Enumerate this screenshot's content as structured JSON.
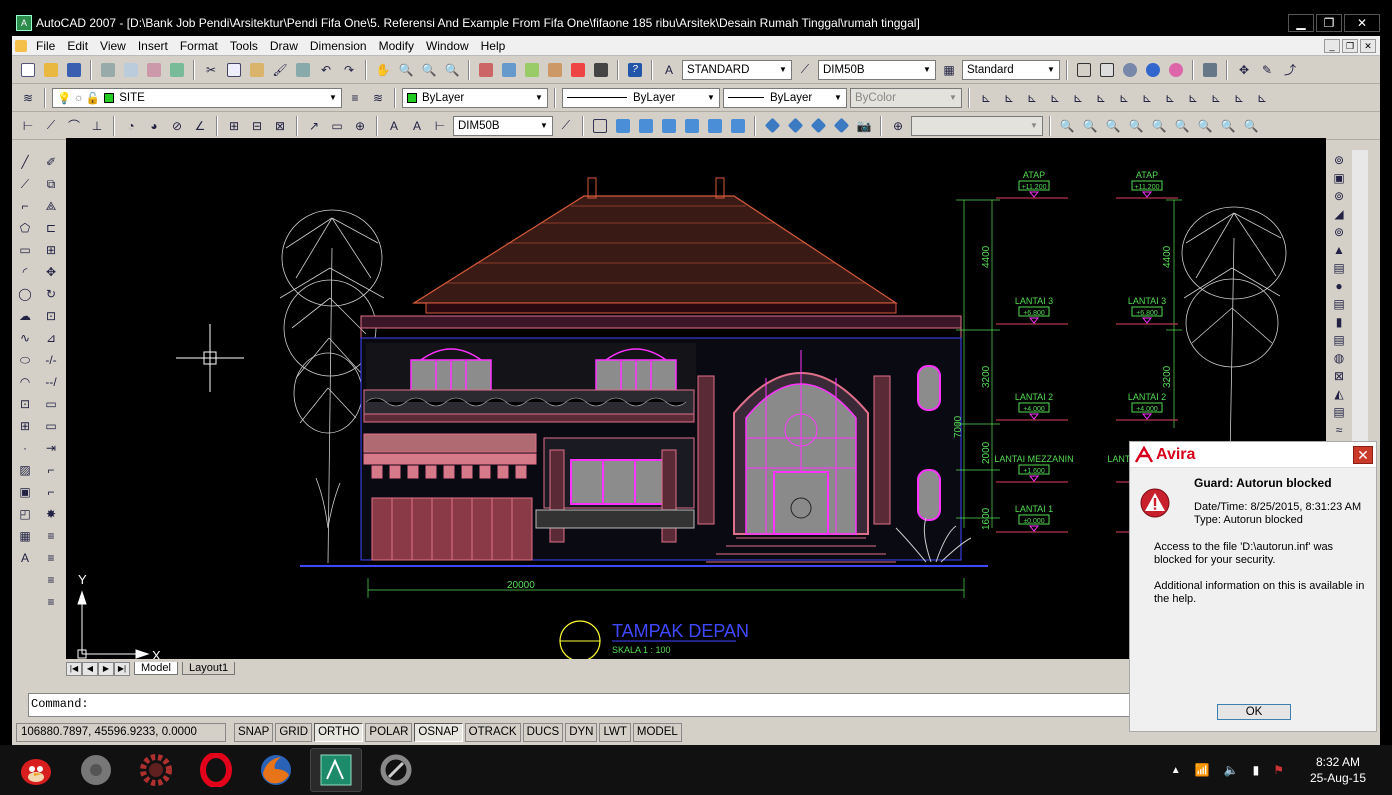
{
  "window": {
    "title": "AutoCAD 2007 - [D:\\Bank Job Pendi\\Arsitektur\\Pendi Fifa One\\5. Referensi And Example From Fifa One\\fifaone 185 ribu\\Arsitek\\Desain Rumah Tinggal\\rumah tinggal]",
    "app_icon_text": "A"
  },
  "menu": [
    "File",
    "Edit",
    "View",
    "Insert",
    "Format",
    "Tools",
    "Draw",
    "Dimension",
    "Modify",
    "Window",
    "Help"
  ],
  "toolbar_styles": {
    "text_style": "STANDARD",
    "dim_style": "DIM50B",
    "table_style": "Standard"
  },
  "toolbar_layers": {
    "layer": "SITE",
    "color": "ByLayer",
    "linetype": "ByLayer",
    "lineweight": "ByLayer",
    "plotstyle": "ByColor"
  },
  "toolbar_dim": {
    "dim_style": "DIM50B"
  },
  "drawing": {
    "levels_left": [
      {
        "name": "ATAP",
        "value": "+11.200"
      },
      {
        "name": "LANTAI 3",
        "value": "+6.800"
      },
      {
        "name": "LANTAI 2",
        "value": "+4.000"
      },
      {
        "name": "LANTAI MEZZANIN",
        "value": "+1.600"
      },
      {
        "name": "LANTAI 1",
        "value": "±0.000"
      }
    ],
    "levels_right": [
      {
        "name": "ATAP",
        "value": "+11.200"
      },
      {
        "name": "LANTAI 3",
        "value": "+6.800"
      },
      {
        "name": "LANTAI 2",
        "value": "+4.000"
      },
      {
        "name": "LANTAI MEZZANIN",
        "value": ""
      },
      {
        "name": "LA",
        "value": ""
      }
    ],
    "dims_vertical": [
      "4400",
      "3200",
      "2000",
      "1600"
    ],
    "dims_vertical_right": [
      "4400",
      "3200"
    ],
    "dim_total_height": "7000",
    "dim_width": "20000",
    "view_title": "TAMPAK DEPAN",
    "view_scale": "SKALA  1 : 100",
    "ucs_x": "X",
    "ucs_y": "Y"
  },
  "layout_tabs": [
    "Model",
    "Layout1"
  ],
  "command": {
    "prompt": "Command:"
  },
  "status": {
    "coords": "106880.7897, 45596.9233, 0.0000",
    "buttons": [
      "SNAP",
      "GRID",
      "ORTHO",
      "POLAR",
      "OSNAP",
      "OTRACK",
      "DUCS",
      "DYN",
      "LWT",
      "MODEL"
    ]
  },
  "avira": {
    "brand": "Avira",
    "title": "Guard: Autorun blocked",
    "datetime": "Date/Time: 8/25/2015, 8:31:23 AM",
    "type": "Type: Autorun blocked",
    "message": "Access to the file 'D:\\autorun.inf' was blocked for your security.",
    "help": "Additional information on this is available in the help.",
    "ok_label": "OK",
    "close_label": "✕"
  },
  "taskbar": {
    "time": "8:32 AM",
    "date": "25-Aug-15"
  },
  "colors": {
    "roof": "#d85a3c",
    "wall": "#e0708a",
    "magenta": "#ff33ff",
    "level_line": "#e04060",
    "dim_green": "#55dd55",
    "title_blue": "#3f48ff",
    "tree": "#c8c8c8",
    "circle": "#ffff33"
  }
}
